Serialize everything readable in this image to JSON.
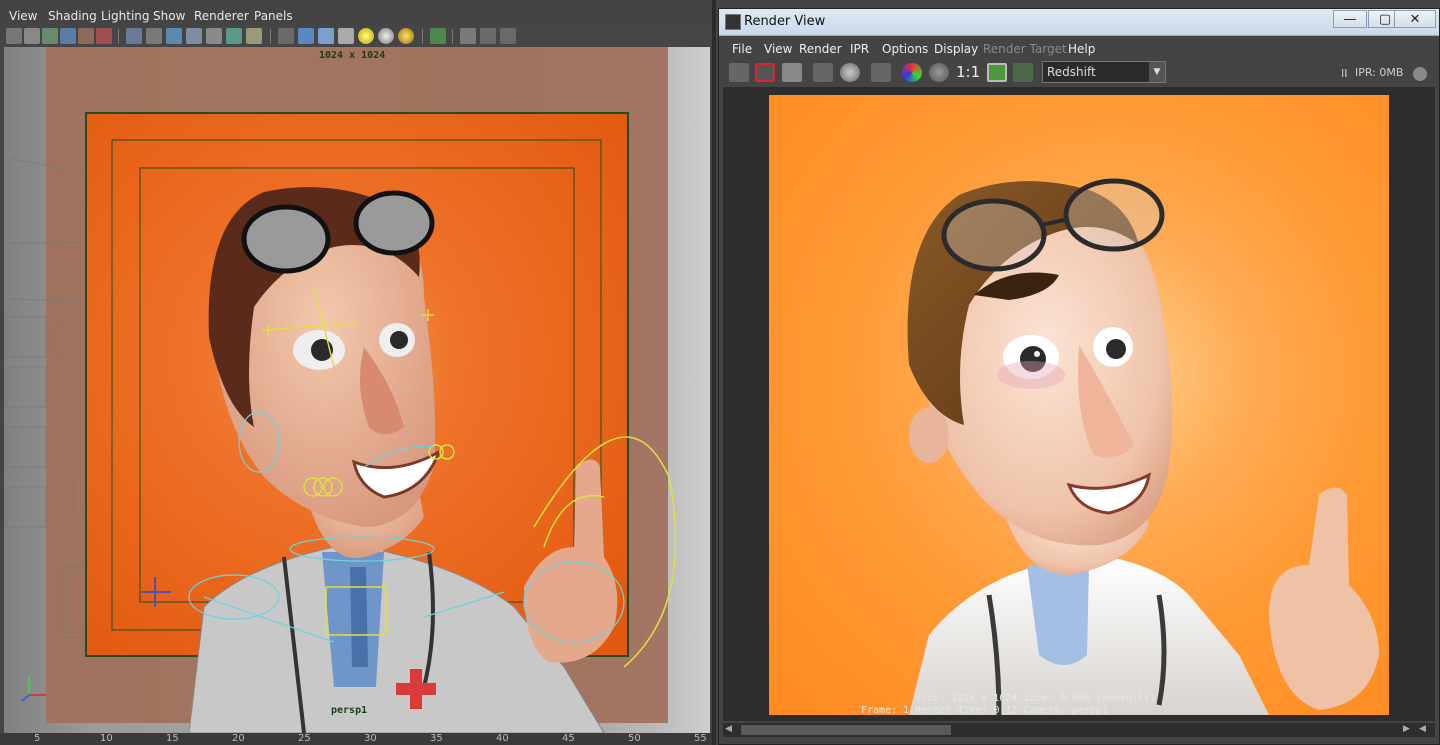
{
  "viewport": {
    "menu": [
      "View",
      "Shading",
      "Lighting",
      "Show",
      "Renderer",
      "Panels"
    ],
    "resolution_label": "1024 x 1024",
    "camera_label": "persp1",
    "ruler_ticks": [
      "5",
      "10",
      "15",
      "20",
      "25",
      "30",
      "35",
      "40",
      "45",
      "50",
      "55"
    ]
  },
  "render_view": {
    "title": "Render View",
    "window_buttons": {
      "minimize": "—",
      "maximize": "▢",
      "close": "✕"
    },
    "menu": [
      "File",
      "View",
      "Render",
      "IPR",
      "Options",
      "Display",
      "Render Target",
      "Help"
    ],
    "zoom_label": "1:1",
    "renderer": "Redshift",
    "ipr_pause": "II",
    "ipr_memory": "IPR: 0MB",
    "overlay_line1": "size: 1024 x 1024 zoom: 0.606     (Redshift)",
    "overlay_line2": "Frame: 1        Render Time: 0:12        Camera: persp1"
  },
  "colors": {
    "accent_orange": "#ff8c1e",
    "viewport_orange": "#e65a12",
    "ui_gray": "#444444"
  }
}
